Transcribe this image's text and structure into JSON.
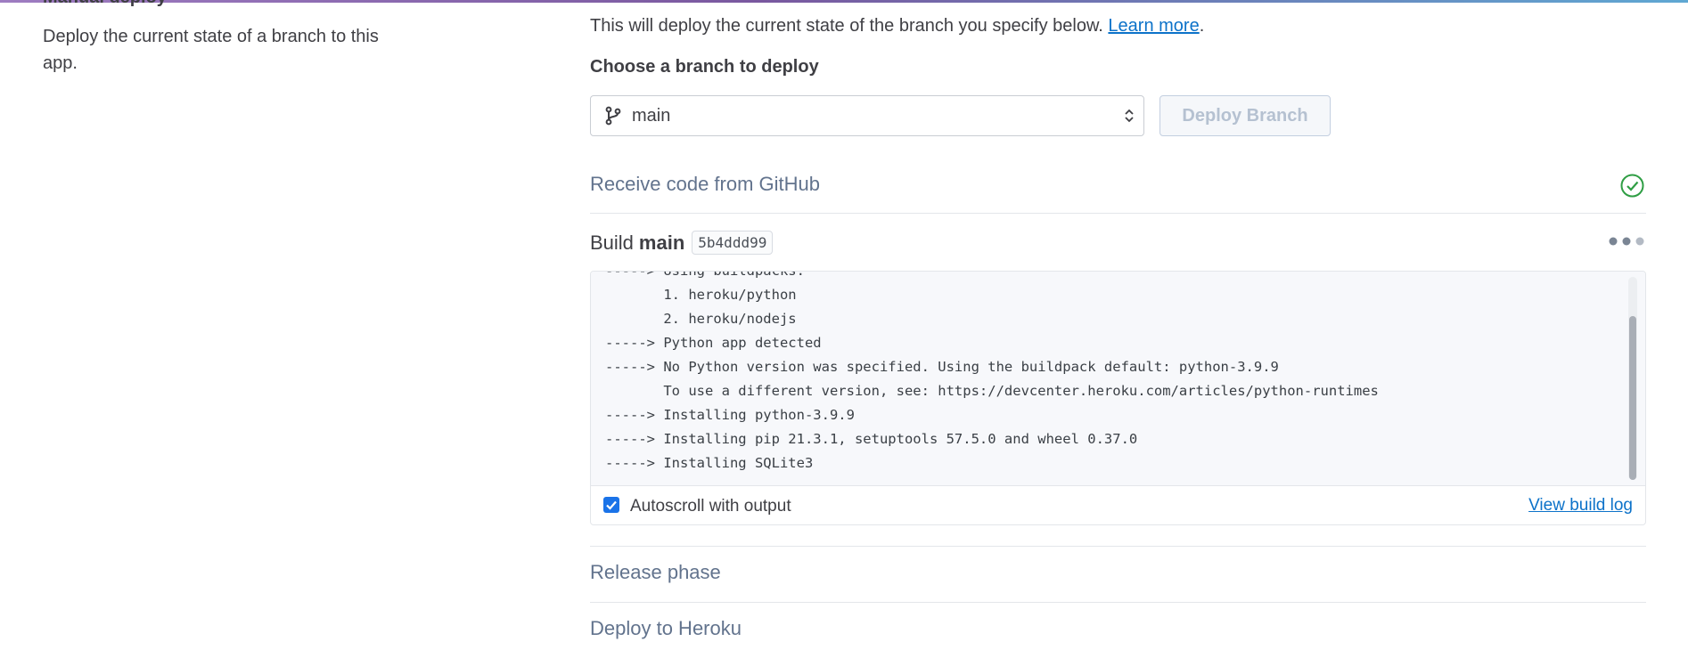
{
  "section": {
    "title": "Manual deploy",
    "description": "Deploy the current state of a branch to this app."
  },
  "intro": {
    "text": "This will deploy the current state of the branch you specify below.",
    "link": "Learn more",
    "suffix": "."
  },
  "branch_picker": {
    "label": "Choose a branch to deploy",
    "selected": "main",
    "deploy_button": "Deploy Branch"
  },
  "steps": {
    "receive": "Receive code from GitHub",
    "build_label": "Build",
    "build_branch": "main",
    "build_commit": "5b4ddd99",
    "release": "Release phase",
    "deploy": "Deploy to Heroku"
  },
  "log": {
    "lines": [
      "-----> Using buildpacks:",
      "       1. heroku/python",
      "       2. heroku/nodejs",
      "-----> Python app detected",
      "-----> No Python version was specified. Using the buildpack default: python-3.9.9",
      "       To use a different version, see: https://devcenter.heroku.com/articles/python-runtimes",
      "-----> Installing python-3.9.9",
      "-----> Installing pip 21.3.1, setuptools 57.5.0 and wheel 0.37.0",
      "-----> Installing SQLite3"
    ],
    "autoscroll_label": "Autoscroll with output",
    "autoscroll_checked": true,
    "view_log_link": "View build log"
  },
  "icons": {
    "branch": "git-branch-icon",
    "select_arrows": "chevron-up-down-icon",
    "success": "check-circle-icon",
    "more": "more-dots-icon",
    "checkbox": "checkbox-checked-icon"
  },
  "colors": {
    "link": "#0c72c9",
    "success": "#2f9e44",
    "checkbox": "#1a73e8",
    "disabled_button_text": "#b5c1d1"
  }
}
